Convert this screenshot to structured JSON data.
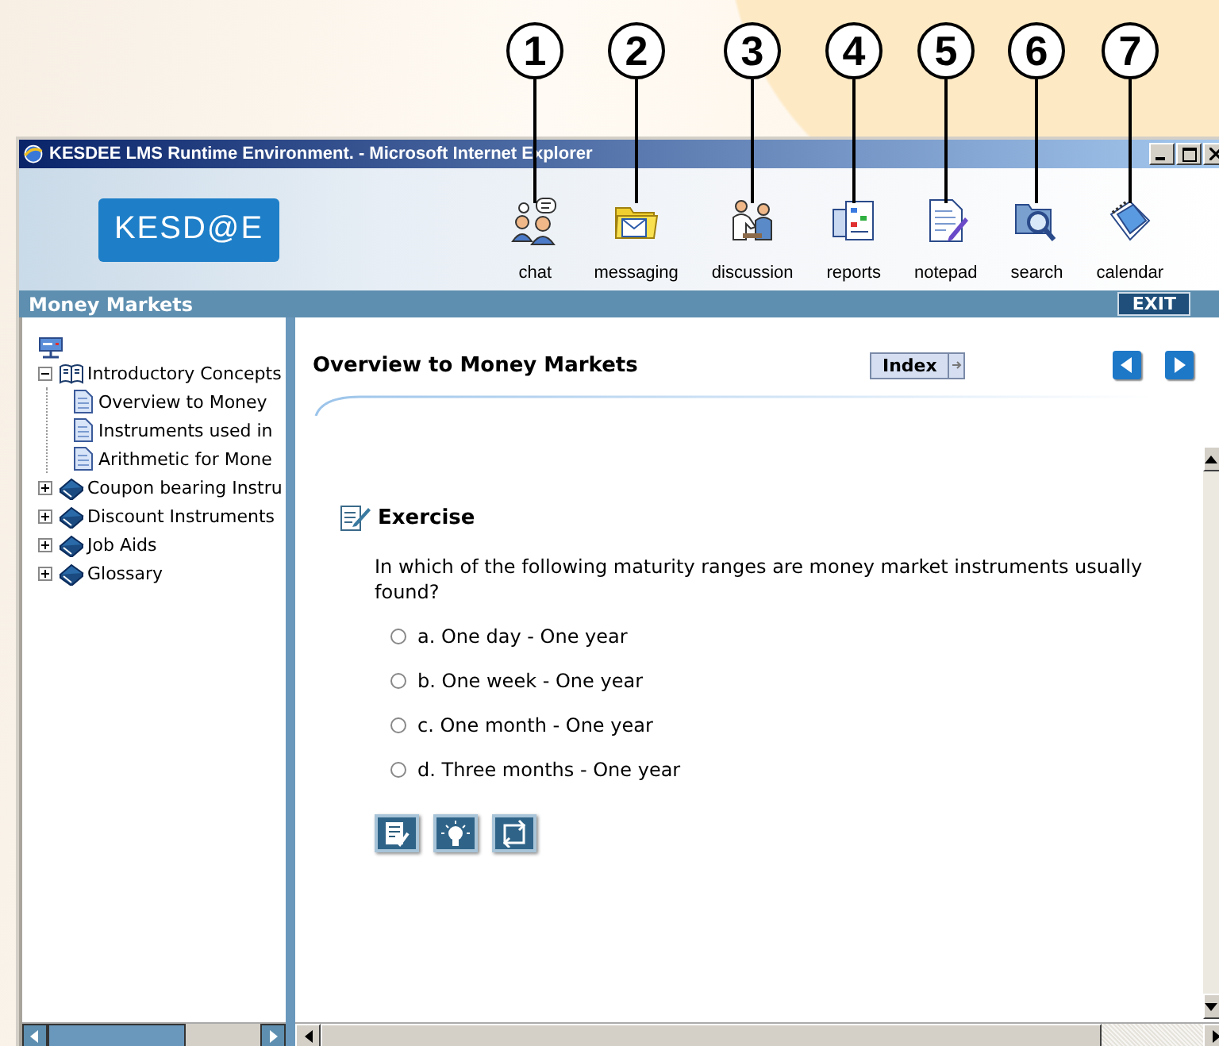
{
  "callouts": [
    "1",
    "2",
    "3",
    "4",
    "5",
    "6",
    "7"
  ],
  "window": {
    "title": "KESDEE LMS Runtime Environment. - Microsoft Internet Explorer"
  },
  "header": {
    "logo": "KESD@E",
    "toolbar": [
      {
        "kind": "chat",
        "label": "chat"
      },
      {
        "kind": "messaging",
        "label": "messaging"
      },
      {
        "kind": "discussion",
        "label": "discussion"
      },
      {
        "kind": "reports",
        "label": "reports"
      },
      {
        "kind": "notepad",
        "label": "notepad"
      },
      {
        "kind": "search",
        "label": "search"
      },
      {
        "kind": "calendar",
        "label": "calendar"
      }
    ]
  },
  "course_bar": {
    "title": "Money Markets",
    "exit": "EXIT"
  },
  "tree": [
    {
      "kind": "open-book",
      "label": "Introductory Concepts",
      "expanded": true,
      "children": [
        {
          "kind": "page",
          "label": "Overview to Money"
        },
        {
          "kind": "page",
          "label": "Instruments used in"
        },
        {
          "kind": "page",
          "label": "Arithmetic for Mone"
        }
      ]
    },
    {
      "kind": "book",
      "label": "Coupon bearing Instru",
      "expanded": false
    },
    {
      "kind": "book",
      "label": "Discount Instruments",
      "expanded": false
    },
    {
      "kind": "book",
      "label": "Job Aids",
      "expanded": false
    },
    {
      "kind": "book",
      "label": "Glossary",
      "expanded": false
    }
  ],
  "content": {
    "title": "Overview to Money Markets",
    "index_button": "Index",
    "section": "Exercise",
    "question": "In which of the following maturity ranges are money market instruments usually found?",
    "options": [
      {
        "label": "a. One day - One year",
        "selected": false
      },
      {
        "label": "b. One week - One year",
        "selected": false
      },
      {
        "label": "c. One month - One year",
        "selected": false
      },
      {
        "label": "d. Three months - One year",
        "selected": false
      }
    ],
    "actions": [
      {
        "kind": "answer"
      },
      {
        "kind": "hint"
      },
      {
        "kind": "retry"
      }
    ]
  }
}
